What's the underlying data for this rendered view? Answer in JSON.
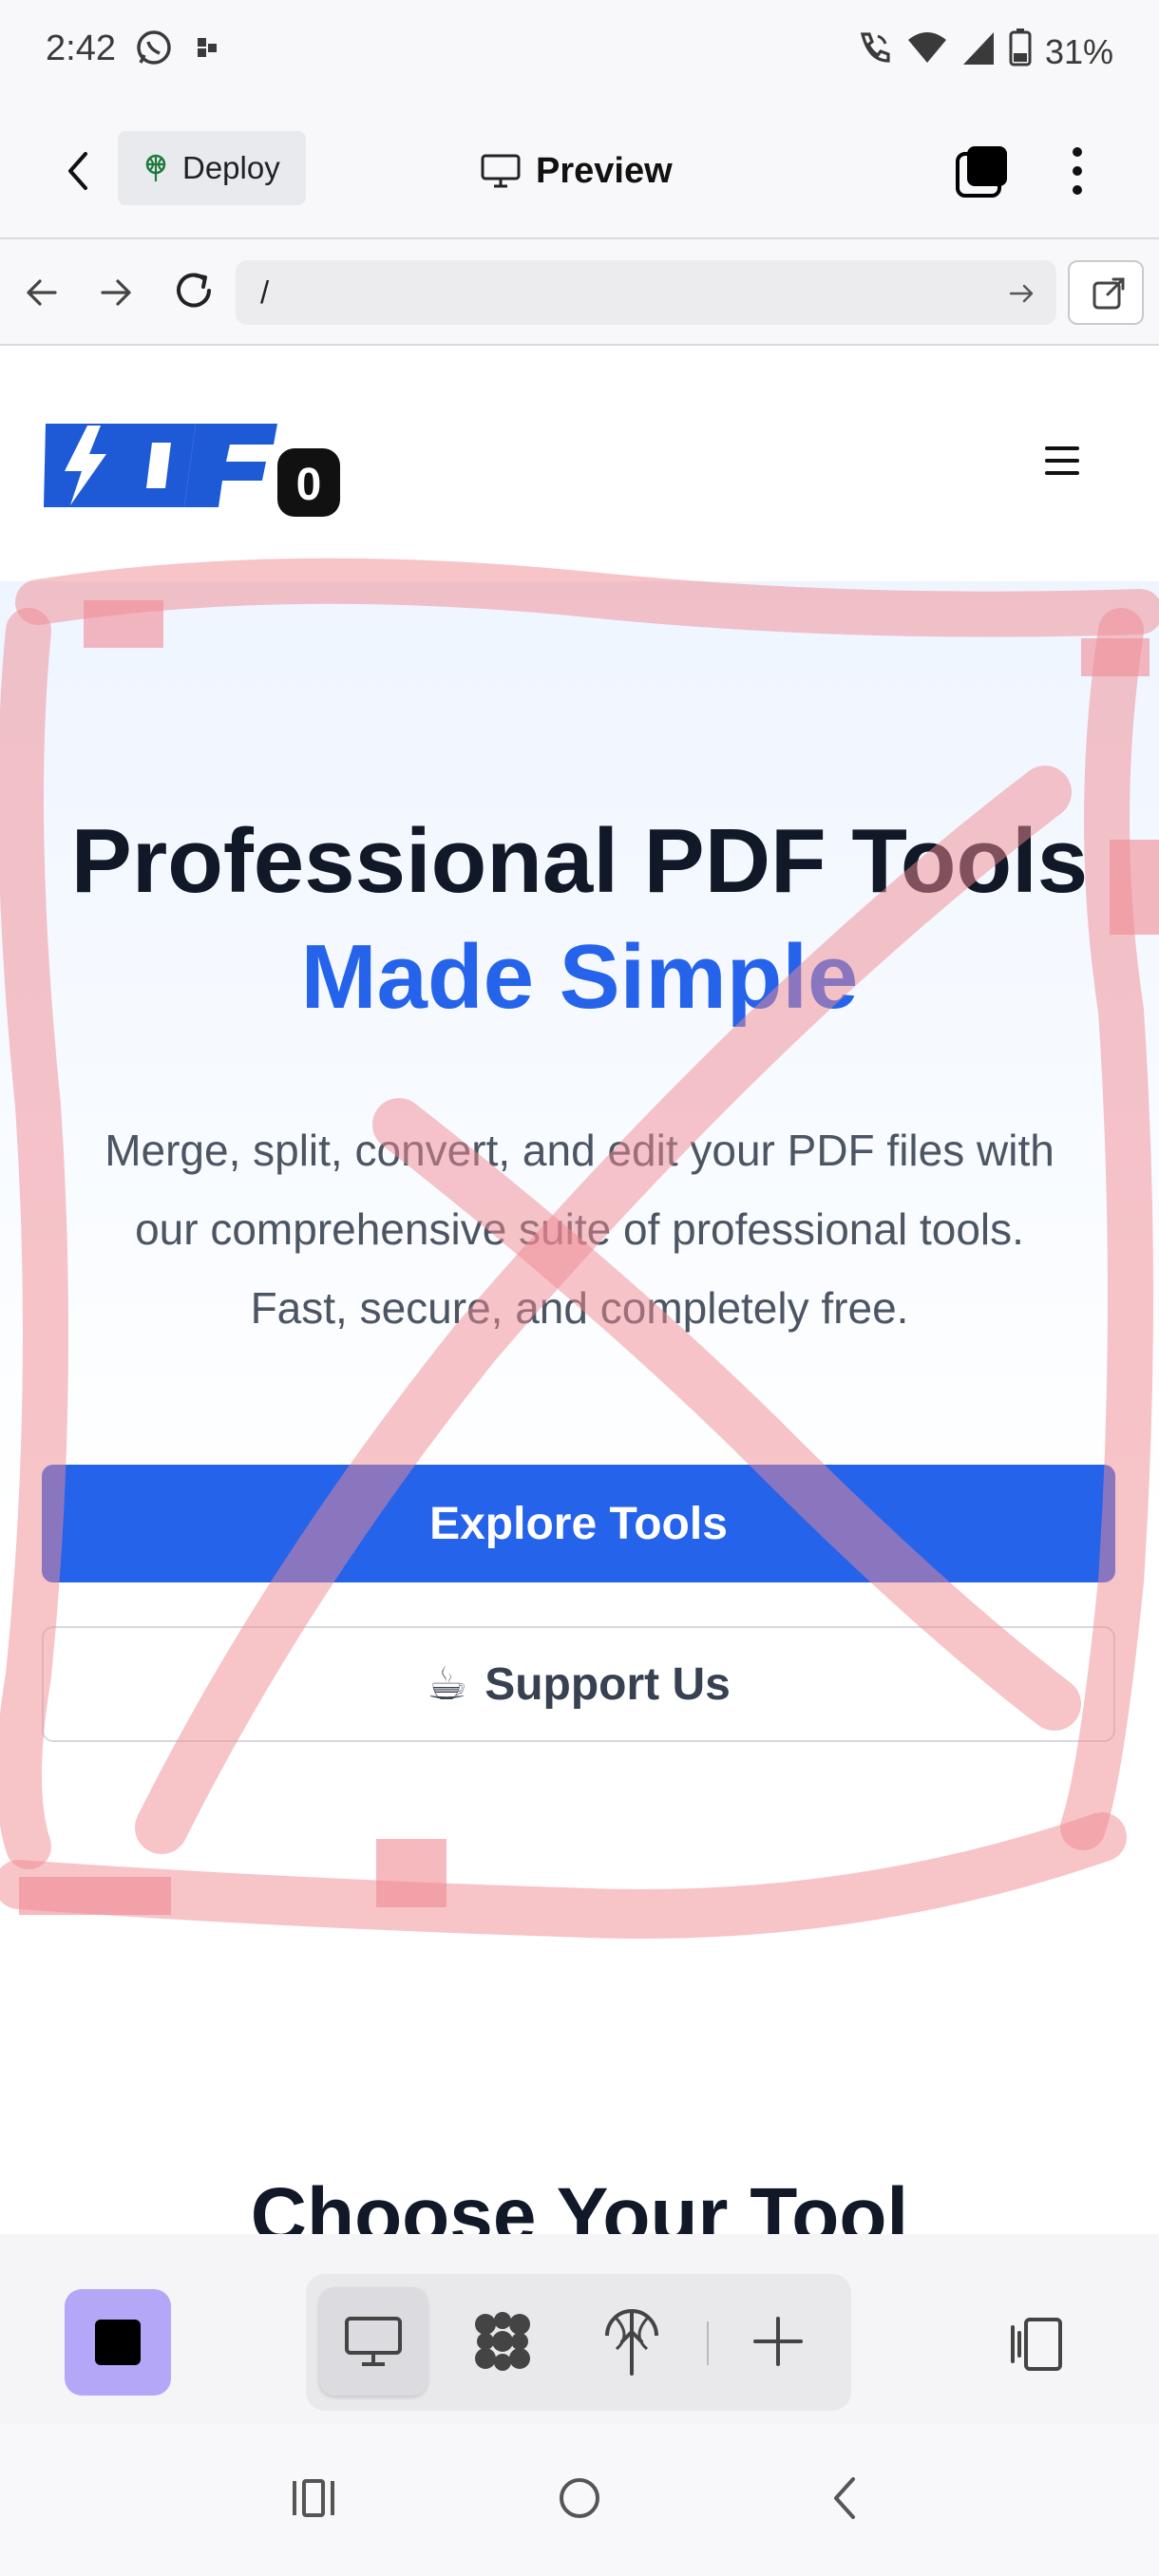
{
  "status_bar": {
    "time": "2:42",
    "battery": "31%",
    "icons": [
      "whatsapp-icon",
      "notification-dot-icon",
      "wifi-calling-icon",
      "wifi-icon",
      "signal-icon",
      "battery-icon"
    ]
  },
  "app_bar": {
    "deploy_label": "Deploy",
    "title": "Preview"
  },
  "url_bar": {
    "url": "/"
  },
  "website": {
    "logo_text": "PDF",
    "logo_badge": "0",
    "hero": {
      "title_line1": "Professional PDF Tools",
      "title_line2": "Made Simple",
      "subtitle_line1": "Merge, split, convert, and edit your PDF files with",
      "subtitle_line2": "our comprehensive suite of professional tools.",
      "subtitle_line3": "Fast, secure, and completely free.",
      "primary_button": "Explore Tools",
      "secondary_button": "Support Us",
      "secondary_emoji": "☕"
    },
    "section_title": "Choose Your Tool"
  },
  "colors": {
    "accent": "#2563eb",
    "scribble": "#f08a92",
    "stop_button": "#b4a7f8"
  }
}
